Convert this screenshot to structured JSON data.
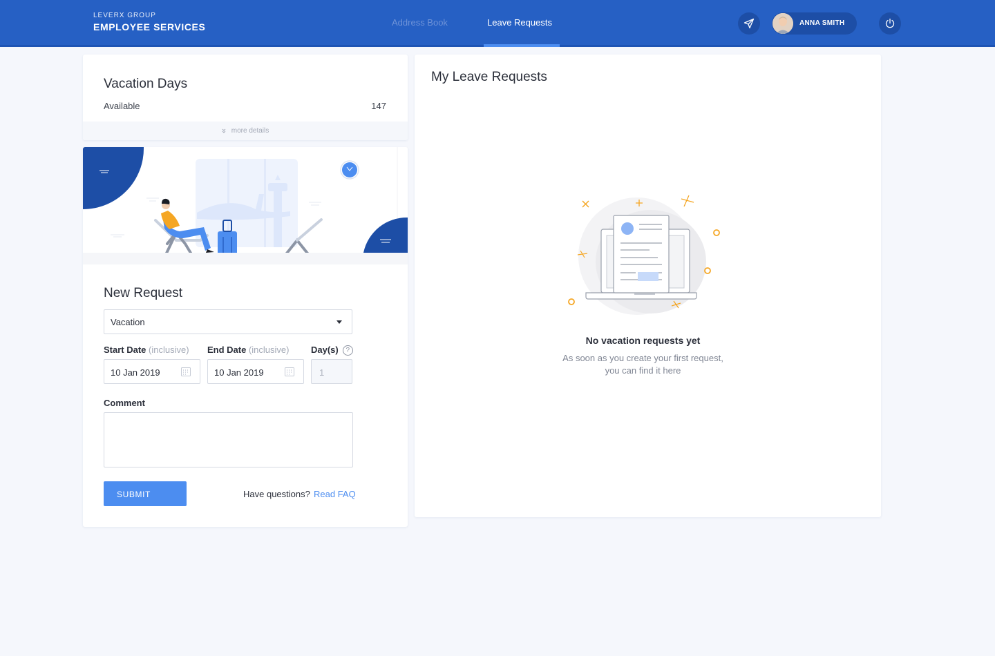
{
  "header": {
    "company": "LEVERX GROUP",
    "app_name": "EMPLOYEE SERVICES",
    "tabs": [
      {
        "label": "Address Book",
        "active": false
      },
      {
        "label": "Leave Requests",
        "active": true
      }
    ],
    "user_name": "ANNA SMITH",
    "icons": {
      "send": "send-icon",
      "power": "power-icon",
      "avatar": "user-avatar"
    }
  },
  "vacation_days": {
    "title": "Vacation Days",
    "available_label": "Available",
    "available_value": "147",
    "more_details": "more details"
  },
  "new_request": {
    "title": "New Request",
    "type_selected": "Vacation",
    "start_label": "Start Date",
    "start_hint": "(inclusive)",
    "end_label": "End Date",
    "end_hint": "(inclusive)",
    "days_label": "Day(s)",
    "help": "?",
    "start_value": "10 Jan 2019",
    "end_value": "10 Jan 2019",
    "days_value": "1",
    "comment_label": "Comment",
    "comment_value": "",
    "submit_label": "SUBMIT",
    "faq_question": "Have questions?",
    "faq_link": "Read FAQ"
  },
  "my_requests": {
    "title": "My Leave Requests",
    "empty_title": "No vacation requests yet",
    "empty_line1": "As soon as you create your first request,",
    "empty_line2": "you can find it here"
  },
  "colors": {
    "header": "#2660c4",
    "accent": "#4c8df0",
    "background": "#f5f7fc",
    "decor_orange": "#f5a623"
  }
}
